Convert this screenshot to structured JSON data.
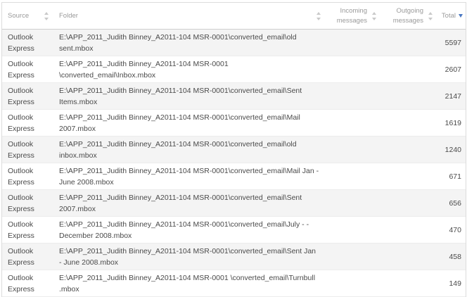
{
  "headers": {
    "source": "Source",
    "folder": "Folder",
    "incoming": "Incoming messages",
    "outgoing": "Outgoing messages",
    "total": "Total"
  },
  "colors": {
    "sort_active": "#4a78c2",
    "stripe": "#f4f4f4"
  },
  "rows": [
    {
      "source": "Outlook Express",
      "folder": "E:\\APP_2011_Judith Binney_A2011-104 MSR-0001\\converted_email\\old sent.mbox",
      "incoming": "",
      "outgoing": "",
      "total": "5597"
    },
    {
      "source": "Outlook Express",
      "folder": "E:\\APP_2011_Judith Binney_A2011-104 MSR-0001 \\converted_email\\Inbox.mbox",
      "incoming": "",
      "outgoing": "",
      "total": "2607"
    },
    {
      "source": "Outlook Express",
      "folder": "E:\\APP_2011_Judith Binney_A2011-104 MSR-0001\\converted_email\\Sent Items.mbox",
      "incoming": "",
      "outgoing": "",
      "total": "2147"
    },
    {
      "source": "Outlook Express",
      "folder": "E:\\APP_2011_Judith Binney_A2011-104 MSR-0001\\converted_email\\Mail 2007.mbox",
      "incoming": "",
      "outgoing": "",
      "total": "1619"
    },
    {
      "source": "Outlook Express",
      "folder": "E:\\APP_2011_Judith Binney_A2011-104 MSR-0001\\converted_email\\old inbox.mbox",
      "incoming": "",
      "outgoing": "",
      "total": "1240"
    },
    {
      "source": "Outlook Express",
      "folder": "E:\\APP_2011_Judith Binney_A2011-104 MSR-0001\\converted_email\\Mail Jan -June 2008.mbox",
      "incoming": "",
      "outgoing": "",
      "total": "671"
    },
    {
      "source": "Outlook Express",
      "folder": "E:\\APP_2011_Judith Binney_A2011-104 MSR-0001\\converted_email\\Sent 2007.mbox",
      "incoming": "",
      "outgoing": "",
      "total": "656"
    },
    {
      "source": "Outlook Express",
      "folder": "E:\\APP_2011_Judith Binney_A2011-104 MSR-0001\\converted_email\\July - - December 2008.mbox",
      "incoming": "",
      "outgoing": "",
      "total": "470"
    },
    {
      "source": "Outlook Express",
      "folder": "E:\\APP_2011_Judith Binney_A2011-104 MSR-0001\\converted_email\\Sent Jan - June 2008.mbox",
      "incoming": "",
      "outgoing": "",
      "total": "458"
    },
    {
      "source": "Outlook Express",
      "folder": "E:\\APP_2011_Judith Binney_A2011-104 MSR-0001 \\converted_email\\Turnbull .mbox",
      "incoming": "",
      "outgoing": "",
      "total": "149"
    }
  ]
}
